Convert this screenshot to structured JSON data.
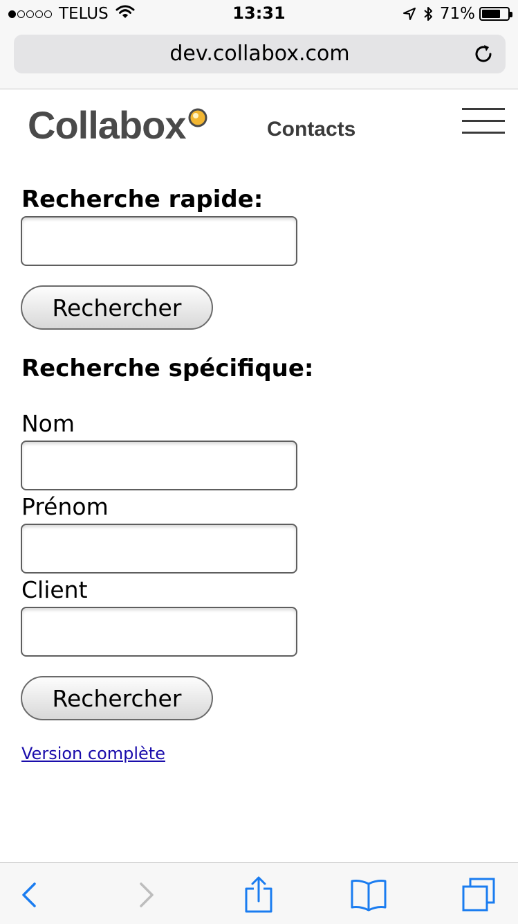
{
  "status_bar": {
    "carrier": "TELUS",
    "time": "13:31",
    "battery_percent": "71%",
    "battery_level": 0.71,
    "signal_bars_filled": 1,
    "signal_bars_total": 5,
    "icons": [
      "wifi-icon",
      "location-arrow-icon",
      "bluetooth-icon",
      "battery-icon"
    ]
  },
  "browser": {
    "url": "dev.collabox.com",
    "icons": [
      "reload-icon"
    ]
  },
  "header": {
    "logo_text": "Collabox",
    "nav_title": "Contacts",
    "menu_icon": "hamburger-menu-icon"
  },
  "quick_search": {
    "heading": "Recherche rapide:",
    "input_value": "",
    "button_label": "Rechercher"
  },
  "specific_search": {
    "heading": "Recherche spécifique:",
    "fields": [
      {
        "label": "Nom",
        "value": ""
      },
      {
        "label": "Prénom",
        "value": ""
      },
      {
        "label": "Client",
        "value": ""
      }
    ],
    "button_label": "Rechercher"
  },
  "footer": {
    "link_label": "Version complète"
  },
  "toolbar": {
    "icons": [
      "back-icon",
      "forward-icon",
      "share-icon",
      "bookmarks-icon",
      "tabs-icon"
    ]
  },
  "colors": {
    "accent_blue": "#1a7cf0",
    "disabled_gray": "#bdbdbd",
    "logo_gray": "#4a4a4a",
    "logo_dot": "#f2b632",
    "link": "#1a0dab"
  }
}
